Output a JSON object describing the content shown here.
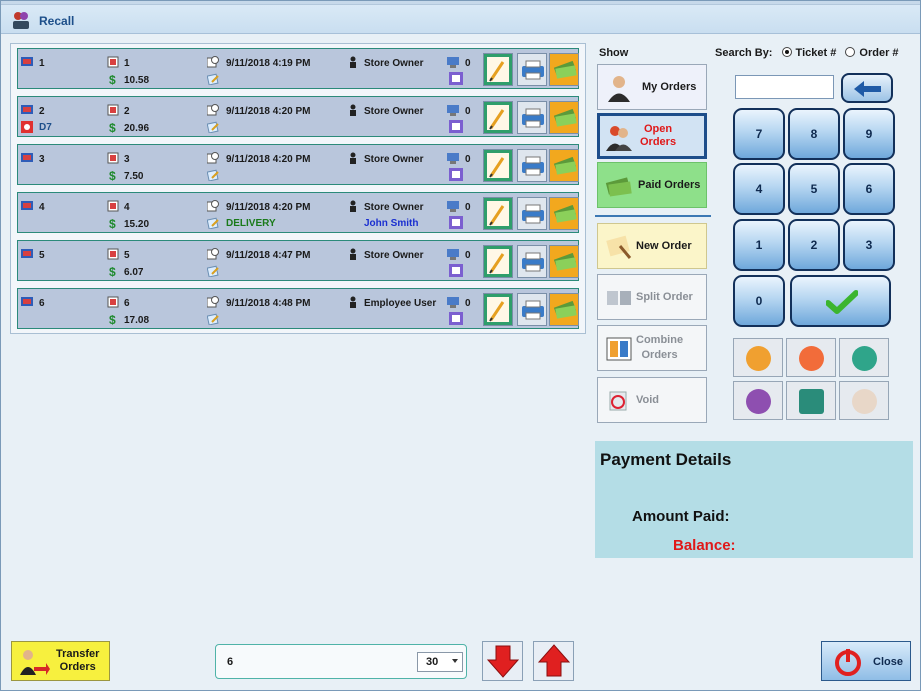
{
  "window": {
    "title": "Recall"
  },
  "orders": [
    {
      "ticket": "1",
      "order": "1",
      "table": "",
      "amount": "10.58",
      "datetime": "9/11/2018 4:19 PM",
      "employee": "Store Owner",
      "note": "",
      "customer": "",
      "guests": "0"
    },
    {
      "ticket": "2",
      "order": "2",
      "table": "D7",
      "amount": "20.96",
      "datetime": "9/11/2018 4:20 PM",
      "employee": "Store Owner",
      "note": "",
      "customer": "",
      "guests": "0"
    },
    {
      "ticket": "3",
      "order": "3",
      "table": "",
      "amount": "7.50",
      "datetime": "9/11/2018 4:20 PM",
      "employee": "Store Owner",
      "note": "",
      "customer": "",
      "guests": "0"
    },
    {
      "ticket": "4",
      "order": "4",
      "table": "",
      "amount": "15.20",
      "datetime": "9/11/2018 4:20 PM",
      "employee": "Store Owner",
      "note": "DELIVERY",
      "customer": "John Smith",
      "guests": "0"
    },
    {
      "ticket": "5",
      "order": "5",
      "table": "",
      "amount": "6.07",
      "datetime": "9/11/2018 4:47 PM",
      "employee": "Store Owner",
      "note": "",
      "customer": "",
      "guests": "0"
    },
    {
      "ticket": "6",
      "order": "6",
      "table": "",
      "amount": "17.08",
      "datetime": "9/11/2018 4:48 PM",
      "employee": "Employee User",
      "note": "",
      "customer": "",
      "guests": "0"
    }
  ],
  "show": {
    "label": "Show",
    "my_orders": "My Orders",
    "open_orders_1": "Open",
    "open_orders_2": "Orders",
    "paid_orders": "Paid Orders",
    "new_order": "New Order",
    "split_order": "Split Order",
    "combine_1": "Combine",
    "combine_2": "Orders",
    "void": "Void"
  },
  "search": {
    "label": "Search By:",
    "ticket": "Ticket #",
    "order": "Order #",
    "value": ""
  },
  "keypad": {
    "k7": "7",
    "k8": "8",
    "k9": "9",
    "k4": "4",
    "k5": "5",
    "k6": "6",
    "k1": "1",
    "k2": "2",
    "k3": "3",
    "k0": "0"
  },
  "payment": {
    "title": "Payment Details",
    "amount_paid": "Amount Paid:",
    "balance": "Balance:"
  },
  "bottom": {
    "transfer_1": "Transfer",
    "transfer_2": "Orders",
    "count": "6",
    "page_size": "30",
    "close": "Close"
  },
  "colors": {
    "accent": "#1d4f8a",
    "balance": "#e01818",
    "delivery": "#1a7a1a",
    "customer": "#1a2fd0"
  }
}
